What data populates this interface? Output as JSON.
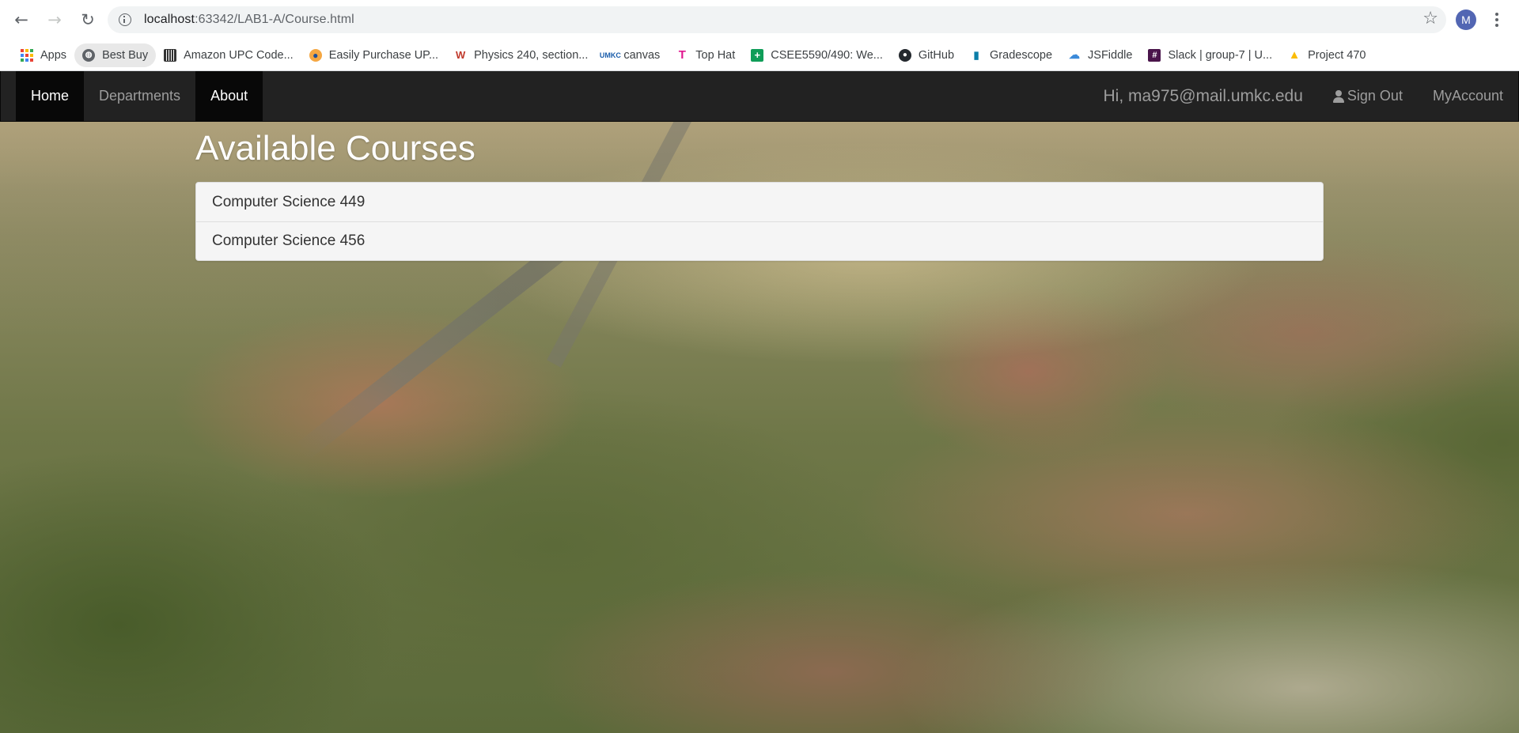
{
  "browser": {
    "url_host": "localhost",
    "url_rest": ":63342/LAB1-A/Course.html",
    "profile_initial": "M"
  },
  "bookmarks": [
    {
      "label": "Apps",
      "icon": "apps-grid-icon"
    },
    {
      "label": "Best Buy",
      "icon": "globe-icon"
    },
    {
      "label": "Amazon UPC Code...",
      "icon": "barcode-icon"
    },
    {
      "label": "Easily Purchase UP...",
      "icon": "shopping-icon"
    },
    {
      "label": "Physics 240, section...",
      "icon": "webassign-icon"
    },
    {
      "label": "canvas",
      "icon": "umkc-icon"
    },
    {
      "label": "Top Hat",
      "icon": "tophat-icon"
    },
    {
      "label": "CSEE5590/490: We...",
      "icon": "sheets-icon"
    },
    {
      "label": "GitHub",
      "icon": "github-icon"
    },
    {
      "label": "Gradescope",
      "icon": "gradescope-icon"
    },
    {
      "label": "JSFiddle",
      "icon": "jsfiddle-icon"
    },
    {
      "label": "Slack | group-7 | U...",
      "icon": "slack-icon"
    },
    {
      "label": "Project 470",
      "icon": "drive-icon"
    }
  ],
  "navbar": {
    "links": [
      "Home",
      "Departments",
      "About"
    ],
    "greeting": "Hi, ma975@mail.umkc.edu",
    "sign_out": "Sign Out",
    "my_account": "MyAccount"
  },
  "main": {
    "title": "Available Courses",
    "courses": [
      "Computer Science 449",
      "Computer Science 456"
    ]
  },
  "colors": {
    "navbar_bg": "#222222",
    "navbar_active": "#080808",
    "navbar_text": "#9d9d9d"
  }
}
